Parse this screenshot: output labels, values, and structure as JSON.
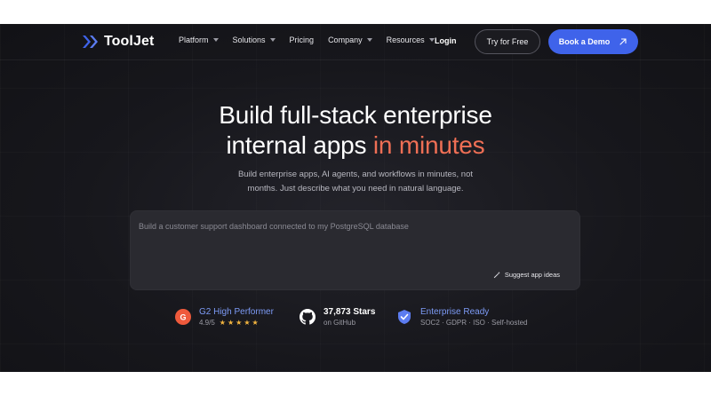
{
  "nav": {
    "brand": "ToolJet",
    "menu": [
      {
        "label": "Platform",
        "has_dropdown": true
      },
      {
        "label": "Solutions",
        "has_dropdown": true
      },
      {
        "label": "Pricing",
        "has_dropdown": false
      },
      {
        "label": "Company",
        "has_dropdown": true
      },
      {
        "label": "Resources",
        "has_dropdown": true
      }
    ],
    "login": "Login",
    "try_free": "Try for Free",
    "book_demo": "Book a Demo"
  },
  "hero": {
    "title_line1": "Build full-stack enterprise",
    "title_line2_plain": "internal apps ",
    "title_line2_accent": "in minutes",
    "subtitle": "Build enterprise apps, AI agents, and workflows in minutes, not months. Just describe what you need in natural language."
  },
  "prompt": {
    "placeholder": "Build a customer support dashboard connected to my PostgreSQL database",
    "value": "",
    "suggest_label": "Suggest app ideas"
  },
  "stats": [
    {
      "title": "G2 High Performer",
      "sub": "4.9/5",
      "stars": "★★★★★",
      "icon": "g2-badge-icon"
    },
    {
      "title": "37,873 Stars",
      "sub": "on GitHub",
      "icon": "github-icon"
    },
    {
      "title": "Enterprise Ready",
      "sub": "SOC2 · GDPR · ISO · Self-hosted",
      "icon": "shield-check-icon"
    }
  ],
  "colors": {
    "accent": "#ef6f55",
    "primary_button": "#3f63ea",
    "background": "#17171c",
    "star": "#f3b53f",
    "link": "#7d9bf6"
  }
}
